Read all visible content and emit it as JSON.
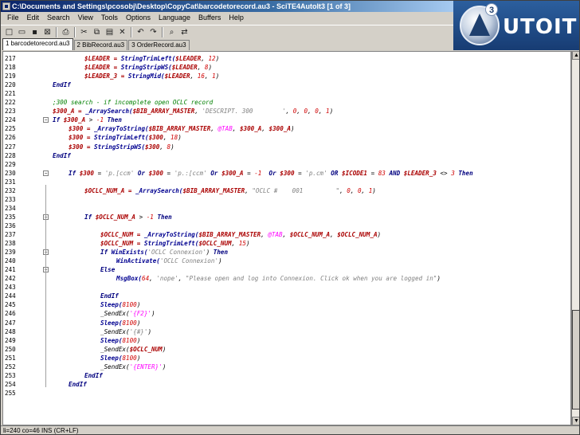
{
  "window": {
    "title": "C:\\Documents and Settings\\pcosobj\\Desktop\\CopyCat\\barcodetorecord.au3 - SciTE4AutoIt3 [1 of 3]"
  },
  "menu": [
    "File",
    "Edit",
    "Search",
    "View",
    "Tools",
    "Options",
    "Language",
    "Buffers",
    "Help"
  ],
  "toolbar": {
    "icons": [
      "new-file-icon",
      "open-file-icon",
      "save-icon",
      "close-file-icon",
      "print-icon",
      "cut-icon",
      "copy-icon",
      "paste-icon",
      "delete-icon",
      "undo-icon",
      "redo-icon",
      "find-icon",
      "replace-icon"
    ],
    "glyphs": [
      "□",
      "▭",
      "▪",
      "⊠",
      "⎙",
      "✂",
      "⧉",
      "▤",
      "✕",
      "↶",
      "↷",
      "⌕",
      "⇄"
    ]
  },
  "tabs": [
    "1 barcodetorecord.au3",
    "2 BibRecord.au3",
    "3 OrderRecord.au3"
  ],
  "logo": {
    "text": "UTOIT",
    "number": "3"
  },
  "colors": {
    "keyword": "#00007f",
    "variable": "#aa0000",
    "function": "#000090",
    "string": "#808080",
    "number": "#d00000",
    "comment": "#008000",
    "plain": "#000000",
    "macro": "#ff00ff"
  },
  "code_lines": [
    {
      "num": "217",
      "indent": 2,
      "fold": "",
      "segments": [
        [
          "$LEADER = ",
          "variable"
        ],
        [
          "StringTrimLeft(",
          "function"
        ],
        [
          "$LEADER",
          "variable"
        ],
        [
          ", ",
          "plain"
        ],
        [
          "12",
          "number"
        ],
        [
          ")",
          "plain"
        ]
      ]
    },
    {
      "num": "218",
      "indent": 2,
      "fold": "",
      "segments": [
        [
          "$LEADER = ",
          "variable"
        ],
        [
          "StringStripWS(",
          "function"
        ],
        [
          "$LEADER",
          "variable"
        ],
        [
          ", ",
          "plain"
        ],
        [
          "8",
          "number"
        ],
        [
          ")",
          "plain"
        ]
      ]
    },
    {
      "num": "219",
      "indent": 2,
      "fold": "",
      "segments": [
        [
          "$LEADER_3 = ",
          "variable"
        ],
        [
          "StringMid(",
          "function"
        ],
        [
          "$LEADER",
          "variable"
        ],
        [
          ", ",
          "plain"
        ],
        [
          "16",
          "number"
        ],
        [
          ", ",
          "plain"
        ],
        [
          "1",
          "number"
        ],
        [
          ")",
          "plain"
        ]
      ]
    },
    {
      "num": "220",
      "indent": 0,
      "fold": "",
      "segments": [
        [
          "EndIf",
          "keyword"
        ]
      ]
    },
    {
      "num": "221",
      "indent": 0,
      "fold": "",
      "segments": []
    },
    {
      "num": "222",
      "indent": 0,
      "fold": "",
      "segments": [
        [
          ";300 search - if incomplete open OCLC record",
          "comment"
        ]
      ]
    },
    {
      "num": "223",
      "indent": 0,
      "fold": "",
      "segments": [
        [
          "$300_A = ",
          "variable"
        ],
        [
          "_ArraySearch(",
          "function"
        ],
        [
          "$BIB_ARRAY_MASTER",
          "variable"
        ],
        [
          ", ",
          "plain"
        ],
        [
          "'DESCRIPT. 300        '",
          "string"
        ],
        [
          ", ",
          "plain"
        ],
        [
          "0",
          "number"
        ],
        [
          ", ",
          "plain"
        ],
        [
          "0",
          "number"
        ],
        [
          ", ",
          "plain"
        ],
        [
          "0",
          "number"
        ],
        [
          ", ",
          "plain"
        ],
        [
          "1",
          "number"
        ],
        [
          ")",
          "plain"
        ]
      ]
    },
    {
      "num": "224",
      "indent": 0,
      "fold": "−",
      "segments": [
        [
          "If ",
          "keyword"
        ],
        [
          "$300_A",
          "variable"
        ],
        [
          " > ",
          "plain"
        ],
        [
          "-1",
          "number"
        ],
        [
          " Then",
          "keyword"
        ]
      ]
    },
    {
      "num": "225",
      "indent": 1,
      "fold": "",
      "segments": [
        [
          "$300 = ",
          "variable"
        ],
        [
          "_ArrayToString(",
          "function"
        ],
        [
          "$BIB_ARRAY_MASTER",
          "variable"
        ],
        [
          ", ",
          "plain"
        ],
        [
          "@TAB",
          "macro"
        ],
        [
          ", ",
          "plain"
        ],
        [
          "$300_A",
          "variable"
        ],
        [
          ", ",
          "plain"
        ],
        [
          "$300_A",
          "variable"
        ],
        [
          ")",
          "plain"
        ]
      ]
    },
    {
      "num": "226",
      "indent": 1,
      "fold": "",
      "segments": [
        [
          "$300 = ",
          "variable"
        ],
        [
          "StringTrimLeft(",
          "function"
        ],
        [
          "$300",
          "variable"
        ],
        [
          ", ",
          "plain"
        ],
        [
          "18",
          "number"
        ],
        [
          ")",
          "plain"
        ]
      ]
    },
    {
      "num": "227",
      "indent": 1,
      "fold": "",
      "segments": [
        [
          "$300 = ",
          "variable"
        ],
        [
          "StringStripWS(",
          "function"
        ],
        [
          "$300",
          "variable"
        ],
        [
          ", ",
          "plain"
        ],
        [
          "8",
          "number"
        ],
        [
          ")",
          "plain"
        ]
      ]
    },
    {
      "num": "228",
      "indent": 0,
      "fold": "",
      "segments": [
        [
          "EndIf",
          "keyword"
        ]
      ]
    },
    {
      "num": "229",
      "indent": 0,
      "fold": "",
      "segments": []
    },
    {
      "num": "230",
      "indent": 1,
      "fold": "−",
      "segments": [
        [
          "If ",
          "keyword"
        ],
        [
          "$300",
          "variable"
        ],
        [
          " = ",
          "plain"
        ],
        [
          "'p.[ccm'",
          "string"
        ],
        [
          " Or ",
          "keyword"
        ],
        [
          "$300",
          "variable"
        ],
        [
          " = ",
          "plain"
        ],
        [
          "'p.:[ccm'",
          "string"
        ],
        [
          " Or ",
          "keyword"
        ],
        [
          "$300_A",
          "variable"
        ],
        [
          " = ",
          "plain"
        ],
        [
          "-1",
          "number"
        ],
        [
          "  Or ",
          "keyword"
        ],
        [
          "$300",
          "variable"
        ],
        [
          " = ",
          "plain"
        ],
        [
          "'p.cm'",
          "string"
        ],
        [
          " OR ",
          "keyword"
        ],
        [
          "$ICODE1",
          "variable"
        ],
        [
          " = ",
          "plain"
        ],
        [
          "83",
          "number"
        ],
        [
          " AND ",
          "keyword"
        ],
        [
          "$LEADER_3",
          "variable"
        ],
        [
          " <> ",
          "plain"
        ],
        [
          "3",
          "number"
        ],
        [
          " Then",
          "keyword"
        ]
      ]
    },
    {
      "num": "231",
      "indent": 0,
      "fold": "",
      "segments": []
    },
    {
      "num": "232",
      "indent": 2,
      "fold": "",
      "segments": [
        [
          "$OCLC_NUM_A = ",
          "variable"
        ],
        [
          "_ArraySearch(",
          "function"
        ],
        [
          "$BIB_ARRAY_MASTER",
          "variable"
        ],
        [
          ", ",
          "plain"
        ],
        [
          "\"OCLC #    001         \"",
          "string"
        ],
        [
          ", ",
          "plain"
        ],
        [
          "0",
          "number"
        ],
        [
          ", ",
          "plain"
        ],
        [
          "0",
          "number"
        ],
        [
          ", ",
          "plain"
        ],
        [
          "1",
          "number"
        ],
        [
          ")",
          "plain"
        ]
      ]
    },
    {
      "num": "233",
      "indent": 0,
      "fold": "",
      "segments": []
    },
    {
      "num": "234",
      "indent": 0,
      "fold": "",
      "segments": []
    },
    {
      "num": "235",
      "indent": 2,
      "fold": "−",
      "segments": [
        [
          "If ",
          "keyword"
        ],
        [
          "$OCLC_NUM_A",
          "variable"
        ],
        [
          " > ",
          "plain"
        ],
        [
          "-1",
          "number"
        ],
        [
          " Then",
          "keyword"
        ]
      ]
    },
    {
      "num": "236",
      "indent": 0,
      "fold": "",
      "segments": []
    },
    {
      "num": "237",
      "indent": 3,
      "fold": "",
      "segments": [
        [
          "$OCLC_NUM = ",
          "variable"
        ],
        [
          "_ArrayToString(",
          "function"
        ],
        [
          "$BIB_ARRAY_MASTER",
          "variable"
        ],
        [
          ", ",
          "plain"
        ],
        [
          "@TAB",
          "macro"
        ],
        [
          ", ",
          "plain"
        ],
        [
          "$OCLC_NUM_A",
          "variable"
        ],
        [
          ", ",
          "plain"
        ],
        [
          "$OCLC_NUM_A",
          "variable"
        ],
        [
          ")",
          "plain"
        ]
      ]
    },
    {
      "num": "238",
      "indent": 3,
      "fold": "",
      "segments": [
        [
          "$OCLC_NUM = ",
          "variable"
        ],
        [
          "StringTrimLeft(",
          "function"
        ],
        [
          "$OCLC_NUM",
          "variable"
        ],
        [
          ", ",
          "plain"
        ],
        [
          "15",
          "number"
        ],
        [
          ")",
          "plain"
        ]
      ]
    },
    {
      "num": "239",
      "indent": 3,
      "fold": "−",
      "segments": [
        [
          "If ",
          "keyword"
        ],
        [
          "WinExists(",
          "function"
        ],
        [
          "'OCLC Connexion'",
          "string"
        ],
        [
          ") ",
          "plain"
        ],
        [
          "Then",
          "keyword"
        ]
      ]
    },
    {
      "num": "240",
      "indent": 4,
      "fold": "",
      "segments": [
        [
          "WinActivate(",
          "function"
        ],
        [
          "'OCLC Connexion'",
          "string"
        ],
        [
          ")",
          "plain"
        ]
      ]
    },
    {
      "num": "241",
      "indent": 3,
      "fold": "−",
      "segments": [
        [
          "Else",
          "keyword"
        ]
      ]
    },
    {
      "num": "242",
      "indent": 4,
      "fold": "",
      "segments": [
        [
          "MsgBox(",
          "function"
        ],
        [
          "64",
          "number"
        ],
        [
          ", ",
          "plain"
        ],
        [
          "'nope'",
          "string"
        ],
        [
          ", ",
          "plain"
        ],
        [
          "\"Please open and log into Connexion. Click ok when you are logged in\"",
          "string"
        ],
        [
          ")",
          "plain"
        ]
      ]
    },
    {
      "num": "243",
      "indent": 0,
      "fold": "",
      "segments": []
    },
    {
      "num": "244",
      "indent": 3,
      "fold": "",
      "segments": [
        [
          "EndIf",
          "keyword"
        ]
      ]
    },
    {
      "num": "245",
      "indent": 3,
      "fold": "",
      "segments": [
        [
          "Sleep(",
          "function"
        ],
        [
          "8100",
          "number"
        ],
        [
          ")",
          "plain"
        ]
      ]
    },
    {
      "num": "246",
      "indent": 3,
      "fold": "",
      "segments": [
        [
          "_SendEx(",
          "plain"
        ],
        [
          "'{F2}'",
          "macro"
        ],
        [
          ")",
          "plain"
        ]
      ]
    },
    {
      "num": "247",
      "indent": 3,
      "fold": "",
      "segments": [
        [
          "Sleep(",
          "function"
        ],
        [
          "8100",
          "number"
        ],
        [
          ")",
          "plain"
        ]
      ]
    },
    {
      "num": "248",
      "indent": 3,
      "fold": "",
      "segments": [
        [
          "_SendEx(",
          "plain"
        ],
        [
          "'{#}'",
          "string"
        ],
        [
          ")",
          "plain"
        ]
      ]
    },
    {
      "num": "249",
      "indent": 3,
      "fold": "",
      "segments": [
        [
          "Sleep(",
          "function"
        ],
        [
          "8100",
          "number"
        ],
        [
          ")",
          "plain"
        ]
      ]
    },
    {
      "num": "250",
      "indent": 3,
      "fold": "",
      "segments": [
        [
          "_SendEx(",
          "plain"
        ],
        [
          "$OCLC_NUM",
          "variable"
        ],
        [
          ")",
          "plain"
        ]
      ]
    },
    {
      "num": "251",
      "indent": 3,
      "fold": "",
      "segments": [
        [
          "Sleep(",
          "function"
        ],
        [
          "8100",
          "number"
        ],
        [
          ")",
          "plain"
        ]
      ]
    },
    {
      "num": "252",
      "indent": 3,
      "fold": "",
      "segments": [
        [
          "_SendEx(",
          "plain"
        ],
        [
          "'{ENTER}'",
          "macro"
        ],
        [
          ")",
          "plain"
        ]
      ]
    },
    {
      "num": "253",
      "indent": 2,
      "fold": "",
      "segments": [
        [
          "EndIf",
          "keyword"
        ]
      ]
    },
    {
      "num": "254",
      "indent": 1,
      "fold": "",
      "segments": [
        [
          "EndIf",
          "keyword"
        ]
      ]
    },
    {
      "num": "255",
      "indent": 0,
      "fold": "",
      "segments": []
    }
  ],
  "statusbar": {
    "text": "li=240 co=46 INS (CR+LF)"
  }
}
